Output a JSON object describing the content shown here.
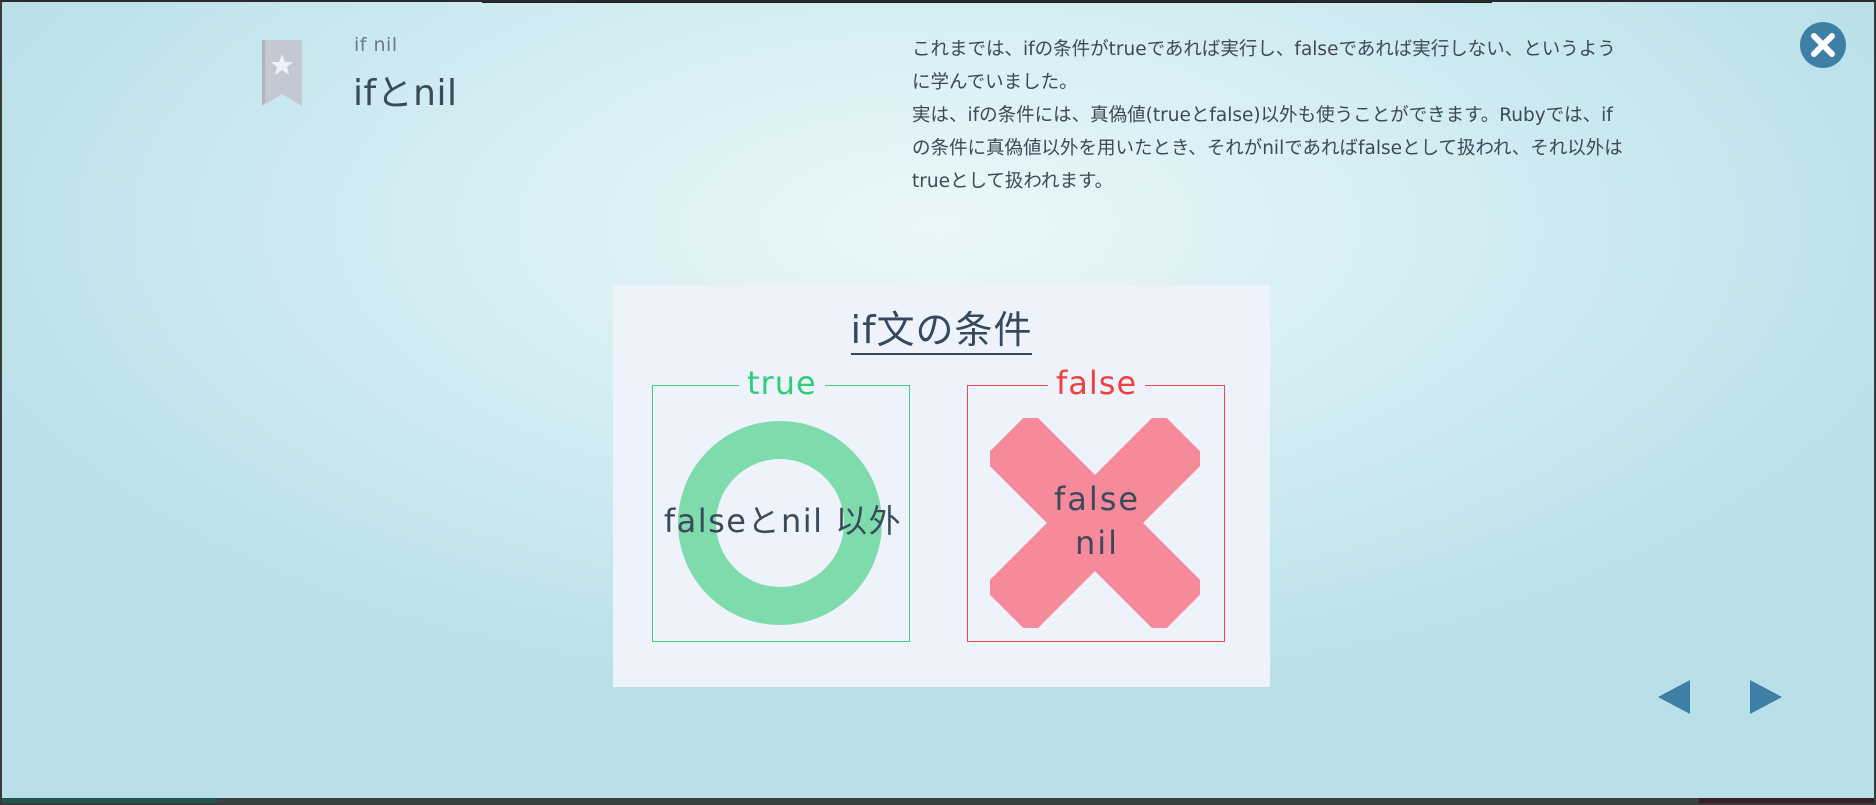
{
  "header": {
    "subtitle": "if nil",
    "title": "ifとnil"
  },
  "description": [
    "これまでは、ifの条件がtrueであれば実行し、falseであれば実行しない、というように学んでいました。",
    "実は、ifの条件には、真偽値(trueとfalse)以外も使うことができます。Rubyでは、ifの条件に真偽値以外を用いたとき、それがnilであればfalseとして扱われ、それ以外はtrueとして扱われます。"
  ],
  "icons": {
    "bookmark": "bookmark-star-icon",
    "close": "close-icon",
    "prev": "arrow-left-icon",
    "next": "arrow-right-icon"
  },
  "slide": {
    "title": "if文の条件",
    "true_panel": {
      "label": "true",
      "text": "falseとnil 以外",
      "color": "#2fcf78",
      "shape_color": "#7ddbac"
    },
    "false_panel": {
      "label": "false",
      "line1": "false",
      "line2": "nil",
      "color": "#ef3f3f",
      "shape_color": "#f68a9b"
    }
  },
  "colors": {
    "accent": "#3e7fa6",
    "text": "#3b4a57"
  }
}
